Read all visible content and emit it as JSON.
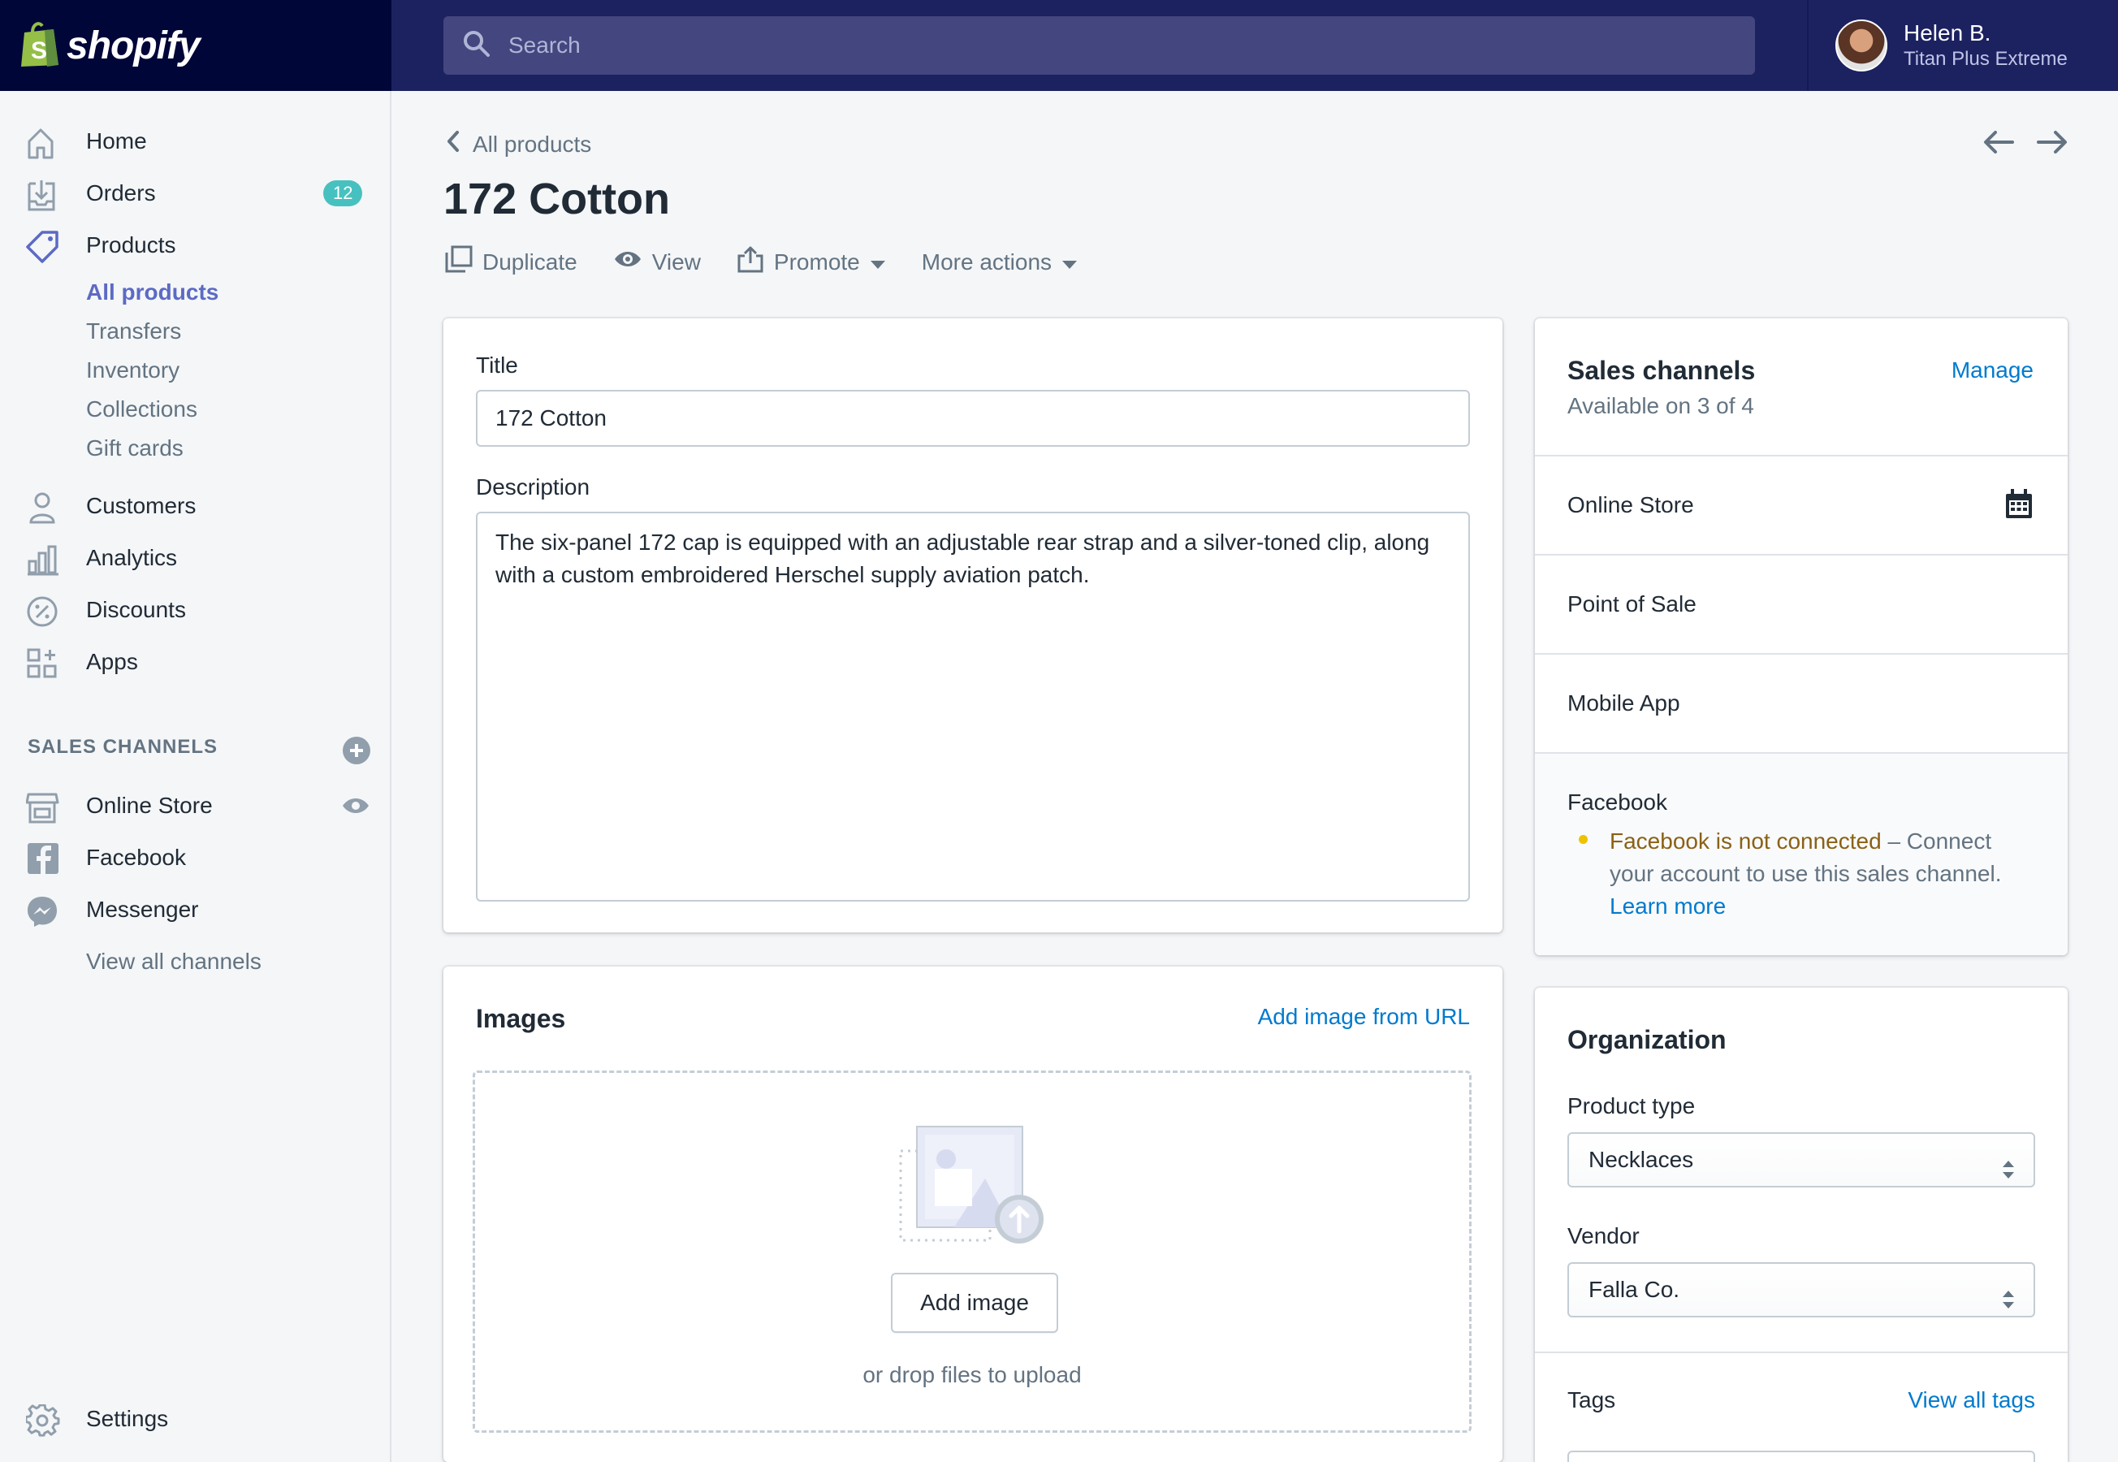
{
  "brand": {
    "name": "shopify"
  },
  "search": {
    "placeholder": "Search"
  },
  "user": {
    "name": "Helen B.",
    "store": "Titan Plus Extreme"
  },
  "sidebar": {
    "items": [
      {
        "label": "Home",
        "icon": "home-icon"
      },
      {
        "label": "Orders",
        "icon": "orders-icon",
        "badge": "12"
      },
      {
        "label": "Products",
        "icon": "tag-icon"
      }
    ],
    "product_subitems": [
      "All products",
      "Transfers",
      "Inventory",
      "Collections",
      "Gift cards"
    ],
    "more_items": [
      {
        "label": "Customers",
        "icon": "person-icon"
      },
      {
        "label": "Analytics",
        "icon": "bar-chart-icon"
      },
      {
        "label": "Discounts",
        "icon": "percent-icon"
      },
      {
        "label": "Apps",
        "icon": "apps-icon"
      }
    ],
    "sales_channels_heading": "SALES CHANNELS",
    "channels": [
      {
        "label": "Online Store",
        "icon": "storefront-icon"
      },
      {
        "label": "Facebook",
        "icon": "facebook-icon"
      },
      {
        "label": "Messenger",
        "icon": "messenger-icon"
      }
    ],
    "view_all_channels": "View all channels",
    "settings": "Settings"
  },
  "breadcrumb": {
    "label": "All products"
  },
  "page": {
    "title": "172 Cotton"
  },
  "actions": {
    "duplicate": "Duplicate",
    "view": "View",
    "promote": "Promote",
    "more": "More actions"
  },
  "product": {
    "title_label": "Title",
    "title_value": "172 Cotton",
    "description_label": "Description",
    "description_value": "The six-panel 172 cap is equipped with an adjustable rear strap and a silver-toned clip, along with a custom embroidered Herschel supply aviation patch."
  },
  "images": {
    "title": "Images",
    "add_from_url": "Add image from URL",
    "add_button": "Add image",
    "drop_hint": "or drop files to upload"
  },
  "sales_channels": {
    "title": "Sales channels",
    "manage": "Manage",
    "availability": "Available on 3 of 4",
    "channels": [
      "Online Store",
      "Point of Sale",
      "Mobile App"
    ],
    "facebook": {
      "label": "Facebook",
      "status": "Facebook is not connected",
      "message_1": " – Connect",
      "message_2": "your account to use this sales channel.",
      "learn_more": "Learn more"
    }
  },
  "organization": {
    "title": "Organization",
    "product_type_label": "Product type",
    "product_type_value": "Necklaces",
    "vendor_label": "Vendor",
    "vendor_value": "Falla Co.",
    "tags_label": "Tags",
    "view_all_tags": "View all tags"
  },
  "colors": {
    "topbar": "#1c2260",
    "brand_bg": "#000638",
    "accent": "#5c6ac4",
    "link": "#007ace",
    "badge": "#47c1bf",
    "warning": "#eec200"
  }
}
